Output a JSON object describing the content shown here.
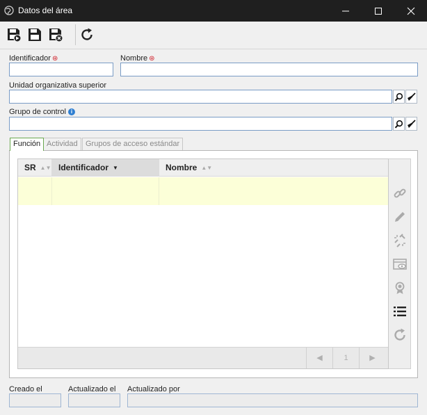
{
  "window": {
    "title": "Datos del área"
  },
  "form": {
    "identificador_label": "Identificador",
    "nombre_label": "Nombre",
    "unidad_label": "Unidad organizativa superior",
    "grupo_label": "Grupo de control",
    "identificador_value": "",
    "nombre_value": "",
    "unidad_value": "",
    "grupo_value": ""
  },
  "tabs": [
    {
      "label": "Función",
      "active": true
    },
    {
      "label": "Actividad",
      "active": false
    },
    {
      "label": "Grupos de acceso estándar",
      "active": false
    }
  ],
  "grid": {
    "columns": [
      "SR",
      "Identificador",
      "Nombre"
    ],
    "sorted_column": "Identificador",
    "page": "1"
  },
  "footer": {
    "creado_label": "Creado el",
    "actualizado_label": "Actualizado el",
    "actualizado_por_label": "Actualizado por"
  },
  "colors": {
    "titlebar": "#1f1f1f",
    "row_highlight": "#fcffd8",
    "required_marker": "#d0202a",
    "info_icon": "#2f7fd1",
    "active_tab_border": "#6aa84f"
  }
}
